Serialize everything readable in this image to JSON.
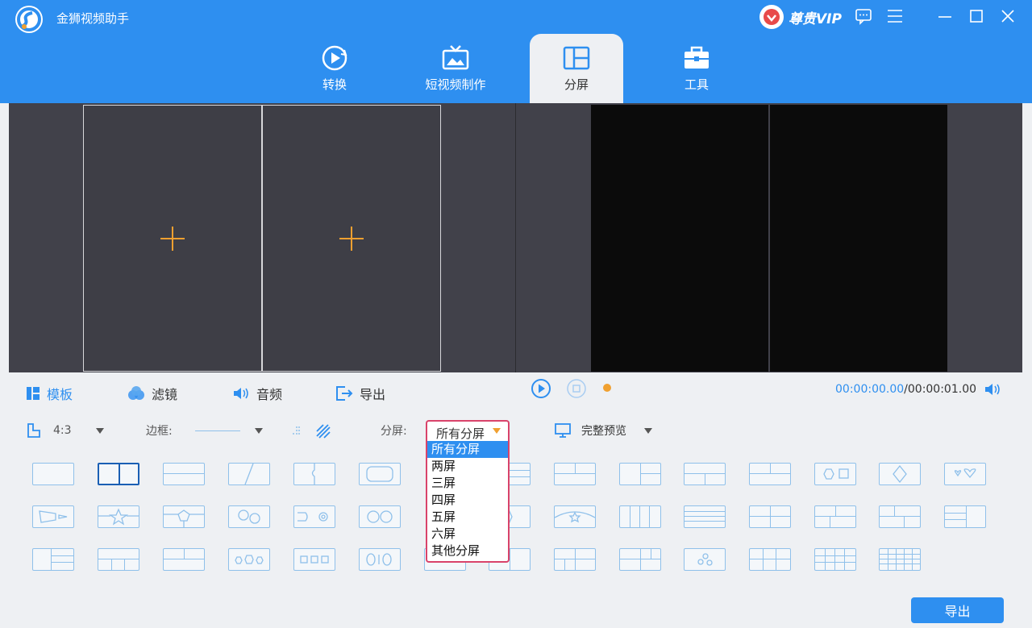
{
  "app": {
    "title": "金狮视频助手",
    "vip_label": "尊贵VIP"
  },
  "tabs": [
    {
      "label": "转换"
    },
    {
      "label": "短视频制作"
    },
    {
      "label": "分屏"
    },
    {
      "label": "工具"
    }
  ],
  "toolbar": {
    "template": "模板",
    "filter": "滤镜",
    "audio": "音频",
    "export": "导出",
    "time_current": "00:00:00.00",
    "time_total": "/00:00:01.00"
  },
  "options": {
    "ratio": "4:3",
    "border_label": "边框:",
    "split_label": "分屏:",
    "split_value": "所有分屏",
    "preview_mode": "完整预览"
  },
  "dropdown": {
    "items": [
      "所有分屏",
      "两屏",
      "三屏",
      "四屏",
      "五屏",
      "六屏",
      "其他分屏"
    ],
    "selected_index": 0
  },
  "footer": {
    "export_button": "导出"
  },
  "colors": {
    "accent": "#2e8ff0",
    "highlight_border": "#d9436a",
    "plus": "#f0a030"
  }
}
